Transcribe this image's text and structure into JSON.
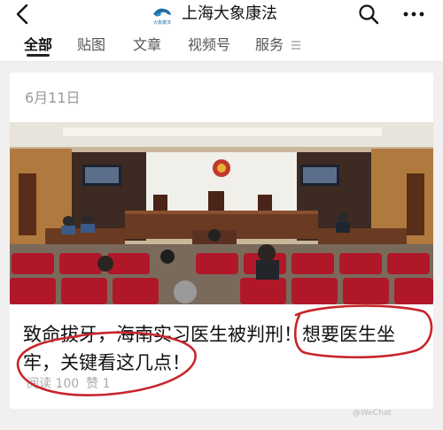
{
  "header": {
    "title": "上海大象康法",
    "logo_text": "大象康法",
    "back_icon": "chevron-left-icon",
    "search_icon": "search-icon",
    "more_icon": "more-dots-icon"
  },
  "tabs": [
    {
      "label": "全部",
      "active": true
    },
    {
      "label": "贴图",
      "active": false
    },
    {
      "label": "文章",
      "active": false
    },
    {
      "label": "视频号",
      "active": false
    },
    {
      "label": "服务",
      "active": false
    }
  ],
  "article": {
    "date": "6月11日",
    "headline": "致命拔牙，海南实习医生被判刑！想要医生坐牢，关键看这几点！",
    "read_label": "阅读 100",
    "like_label": "赞 1"
  },
  "colors": {
    "annotation_red": "#c8262b",
    "court_seat_red": "#b0182a",
    "court_wood": "#6b3a22"
  }
}
